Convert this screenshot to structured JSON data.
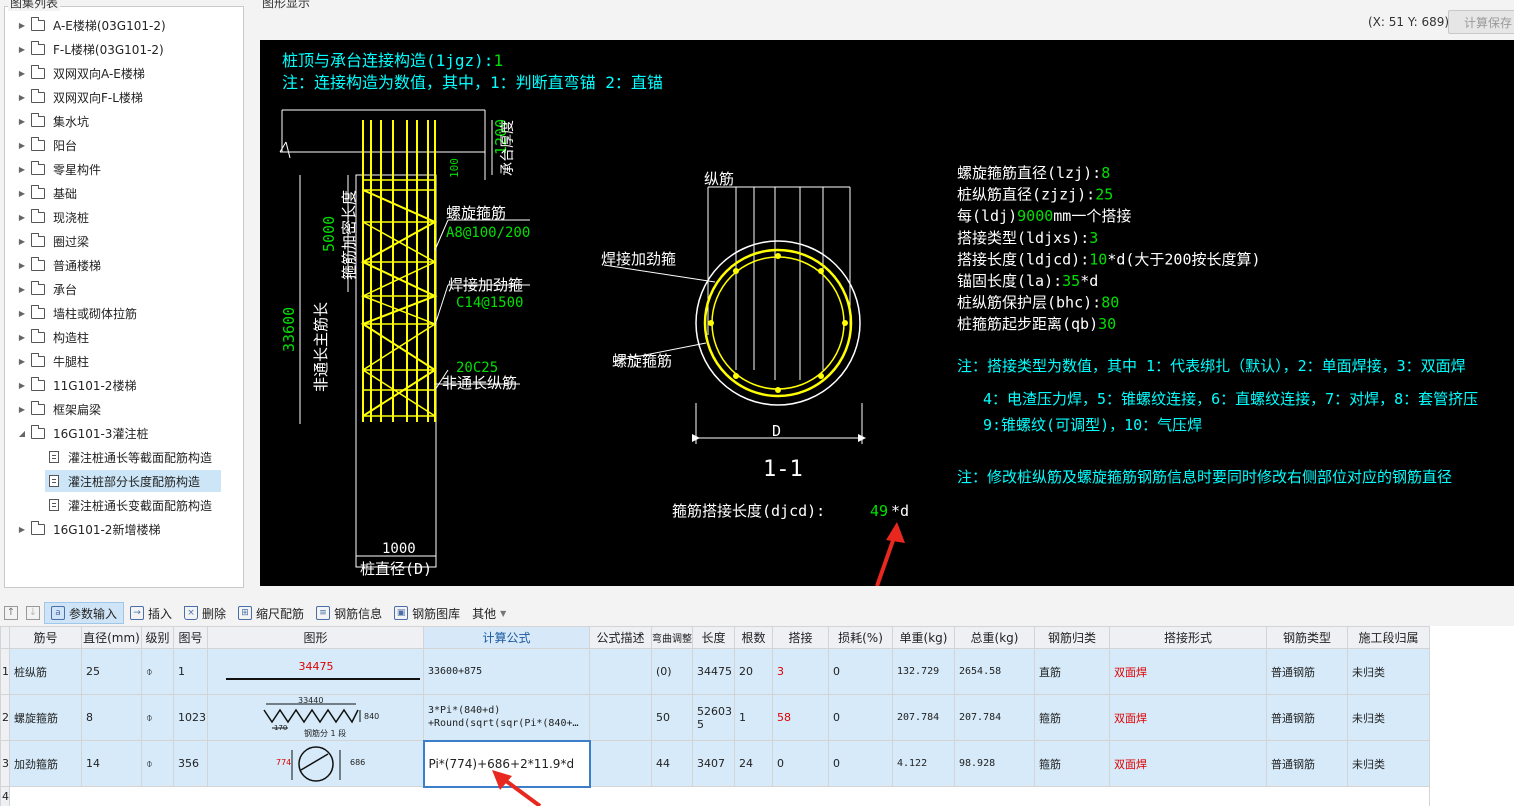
{
  "tree": {
    "title": "图集列表",
    "items": [
      {
        "label": "A-E楼梯(03G101-2)",
        "type": "folder",
        "arrow": "▶"
      },
      {
        "label": "F-L楼梯(03G101-2)",
        "type": "folder",
        "arrow": "▶"
      },
      {
        "label": "双网双向A-E楼梯",
        "type": "folder",
        "arrow": "▶"
      },
      {
        "label": "双网双向F-L楼梯",
        "type": "folder",
        "arrow": "▶"
      },
      {
        "label": "集水坑",
        "type": "folder",
        "arrow": "▶"
      },
      {
        "label": "阳台",
        "type": "folder",
        "arrow": "▶"
      },
      {
        "label": "零星构件",
        "type": "folder",
        "arrow": "▶"
      },
      {
        "label": "基础",
        "type": "folder",
        "arrow": "▶"
      },
      {
        "label": "现浇桩",
        "type": "folder",
        "arrow": "▶"
      },
      {
        "label": "圈过梁",
        "type": "folder",
        "arrow": "▶"
      },
      {
        "label": "普通楼梯",
        "type": "folder",
        "arrow": "▶"
      },
      {
        "label": "承台",
        "type": "folder",
        "arrow": "▶"
      },
      {
        "label": "墙柱或砌体拉筋",
        "type": "folder",
        "arrow": "▶"
      },
      {
        "label": "构造柱",
        "type": "folder",
        "arrow": "▶"
      },
      {
        "label": "牛腿柱",
        "type": "folder",
        "arrow": "▶"
      },
      {
        "label": "11G101-2楼梯",
        "type": "folder",
        "arrow": "▶"
      },
      {
        "label": "框架扁梁",
        "type": "folder",
        "arrow": "▶"
      },
      {
        "label": "16G101-3灌注桩",
        "type": "folder",
        "arrow": "◢"
      },
      {
        "label": "灌注桩通长等截面配筋构造",
        "type": "doc"
      },
      {
        "label": "灌注桩部分长度配筋构造",
        "type": "doc",
        "selected": true
      },
      {
        "label": "灌注桩通长变截面配筋构造",
        "type": "doc"
      },
      {
        "label": "16G101-2新增楼梯",
        "type": "folder",
        "arrow": "▶"
      }
    ]
  },
  "graphic": {
    "title": "图形显示",
    "coord": "(X: 51 Y: 689)",
    "calc_save": "计算保存",
    "lines": {
      "l1a": "桩顶与承台连接构造(1jgz):",
      "l1b": "1",
      "l2": "注：连接构造为数值，其中，1：判断直弯锚    2：直锚",
      "dim_1200": "1200",
      "cap_thick": "承台厚度",
      "dim_100": "100",
      "dim_5000": "5000",
      "stiff_len": "箍筋加密长度",
      "spiral": "螺旋箍筋",
      "spiral_spec": "A8@100/200",
      "weld_hoop": "焊接加劲箍",
      "weld_spec": "C14@1500",
      "dim_33600": "33600",
      "main_len": "非通长主筋长",
      "bar_20c25": "20C25",
      "non_through": "非通长纵筋",
      "dim_1000": "1000",
      "pile_dia": "桩直径(D)",
      "sec_long": "纵筋",
      "sec_weld": "焊接加劲箍",
      "sec_spiral": "螺旋箍筋",
      "sec_D": "D",
      "sec_title": "1-1",
      "lap_a": "箍筋搭接长度(djcd):",
      "lap_b": "49",
      "lap_c": "*d"
    },
    "params": [
      {
        "a": "螺旋箍筋直径(lzj):",
        "b": "8",
        "c": ""
      },
      {
        "a": "桩纵筋直径(zjzj):",
        "b": "25",
        "c": ""
      },
      {
        "a": "每(ldj)",
        "b": "9000",
        "c": "mm一个搭接"
      },
      {
        "a": "搭接类型(ldjxs):",
        "b": "3",
        "c": ""
      },
      {
        "a": "搭接长度(ldjcd):",
        "b": "10",
        "c": "*d(大于200按长度算)"
      },
      {
        "a": "锚固长度(la):",
        "b": "35",
        "c": "*d"
      },
      {
        "a": "桩纵筋保护层(bhc):",
        "b": "80",
        "c": ""
      },
      {
        "a": "桩箍筋起步距离(qb)",
        "b": "30",
        "c": ""
      }
    ],
    "notes": {
      "n1": "注：搭接类型为数值，其中 1：代表绑扎（默认），2：单面焊接，3：双面焊",
      "n2": "4：电渣压力焊，5：锥螺纹连接，6：直螺纹连接，7：对焊，8：套管挤压",
      "n3": "9:锥螺纹(可调型)，10：气压焊",
      "n4": "注：修改桩纵筋及螺旋箍筋钢筋信息时要同时修改右侧部位对应的钢筋直径"
    }
  },
  "toolbar": {
    "param_input": "参数输入",
    "insert": "插入",
    "delete": "删除",
    "scale_rebar": "缩尺配筋",
    "rebar_info": "钢筋信息",
    "rebar_lib": "钢筋图库",
    "other": "其他"
  },
  "table": {
    "headers": [
      "筋号",
      "直径(mm)",
      "级别",
      "图号",
      "图形",
      "计算公式",
      "公式描述",
      "弯曲调整",
      "长度",
      "根数",
      "搭接",
      "损耗(%)",
      "单重(kg)",
      "总重(kg)",
      "钢筋归类",
      "搭接形式",
      "钢筋类型",
      "施工段归属"
    ],
    "rows": [
      {
        "rn": "1",
        "name": "桩纵筋",
        "dia": "25",
        "grade": "⌽",
        "fig": "1",
        "shape_val": "34475",
        "formula": "33600+875",
        "desc": "",
        "bend": "(0)",
        "len": "34475",
        "count": "20",
        "lap": "3",
        "loss": "0",
        "unit_w": "132.729",
        "total_w": "2654.58",
        "cat": "直筋",
        "lap_form": "双面焊",
        "type": "普通钢筋",
        "seg": "未归类"
      },
      {
        "rn": "2",
        "name": "螺旋箍筋",
        "dia": "8",
        "grade": "⌽",
        "fig": "1023",
        "shape_val": "33440",
        "shape_h": "840",
        "shape_seg": "钢筋分 1 段",
        "shape_s": "170",
        "formula": "3*Pi*(840+d)",
        "formula2": "+Round(sqrt(sqr(Pi*(840+…",
        "desc": "",
        "bend": "50",
        "len": "52603",
        "len2": "5",
        "count": "1",
        "lap": "58",
        "loss": "0",
        "unit_w": "207.784",
        "total_w": "207.784",
        "cat": "箍筋",
        "lap_form": "双面焊",
        "type": "普通钢筋",
        "seg": "未归类"
      },
      {
        "rn": "3",
        "name": "加劲箍筋",
        "dia": "14",
        "grade": "⌽",
        "fig": "356",
        "shape_val": "774",
        "shape_r": "686",
        "formula": "Pi*(774)+686+2*11.9*d",
        "desc": "",
        "bend": "44",
        "len": "3407",
        "count": "24",
        "lap": "0",
        "loss": "0",
        "unit_w": "4.122",
        "total_w": "98.928",
        "cat": "箍筋",
        "lap_form": "双面焊",
        "type": "普通钢筋",
        "seg": "未归类"
      },
      {
        "rn": "4"
      }
    ]
  },
  "colors": {
    "cad_bg": "#000000",
    "cad_yellow": "#ffff00",
    "cad_cyan": "#00ffff",
    "cad_green": "#00e000",
    "cad_white": "#ffffff",
    "arrow_red": "#e8281e",
    "row_bg": "#d6eaf9"
  }
}
